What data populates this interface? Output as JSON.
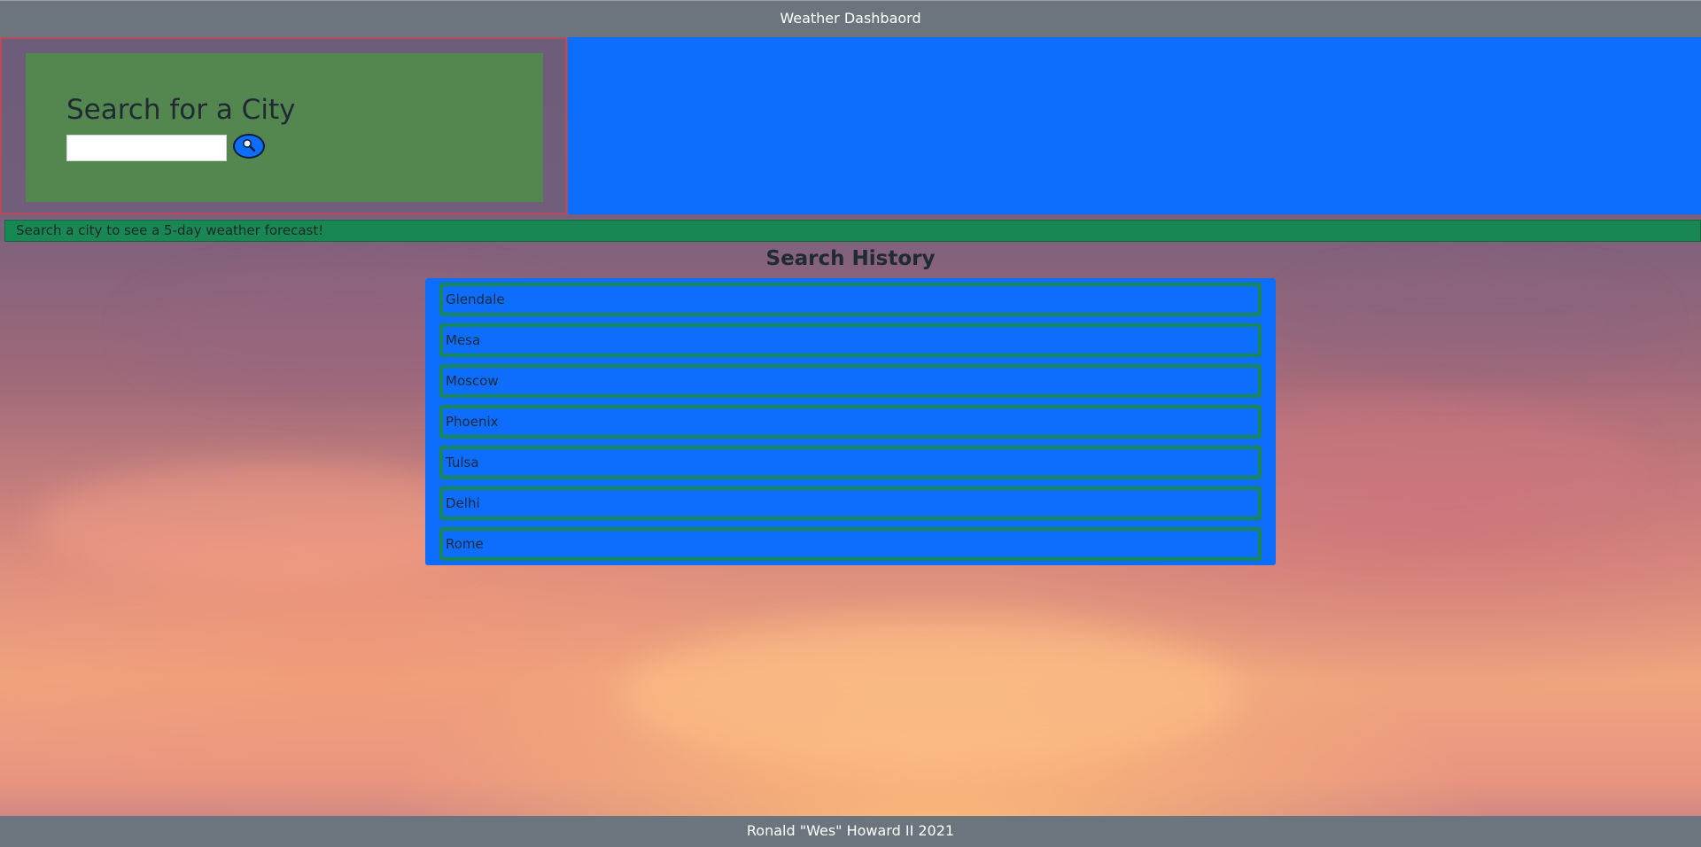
{
  "header": {
    "title": "Weather Dashbaord"
  },
  "search": {
    "title": "Search for a City",
    "input_value": "",
    "placeholder": "",
    "button_icon": "search-icon"
  },
  "status": {
    "message": "Search a city to see a 5-day weather forecast!"
  },
  "history": {
    "title": "Search History",
    "items": [
      "Glendale",
      "Mesa",
      "Moscow",
      "Phoenix",
      "Tulsa",
      "Delhi",
      "Rome"
    ]
  },
  "footer": {
    "text": "Ronald \"Wes\" Howard II 2021"
  },
  "colors": {
    "bar_gray": "#6c757d",
    "primary_blue": "#0d6efd",
    "success_green": "#198754",
    "card_green": "#548650",
    "panel_border": "#b84a5a"
  }
}
